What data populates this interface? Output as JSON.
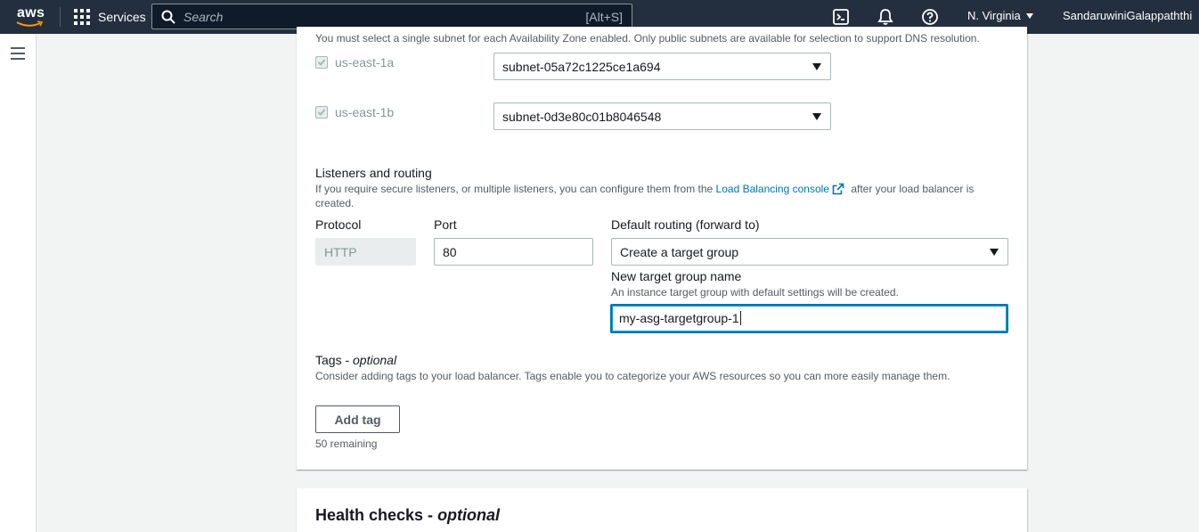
{
  "topnav": {
    "logo_text": "aws",
    "services_label": "Services",
    "search_placeholder": "Search",
    "search_shortcut": "[Alt+S]",
    "region": "N. Virginia",
    "user": "SandaruwiniGalappaththi"
  },
  "subnets": {
    "note": "You must select a single subnet for each Availability Zone enabled. Only public subnets are available for selection to support DNS resolution.",
    "zones": [
      {
        "az": "us-east-1a",
        "subnet": "subnet-05a72c1225ce1a694",
        "checked": true
      },
      {
        "az": "us-east-1b",
        "subnet": "subnet-0d3e80c01b8046548",
        "checked": true
      }
    ]
  },
  "listeners": {
    "title": "Listeners and routing",
    "desc_before": "If you require secure listeners, or multiple listeners, you can configure them from the ",
    "desc_link": "Load Balancing console",
    "desc_after": " after your load balancer is",
    "desc_line2": "created.",
    "protocol_label": "Protocol",
    "protocol_value": "HTTP",
    "port_label": "Port",
    "port_value": "80",
    "routing_label": "Default routing (forward to)",
    "routing_value": "Create a target group",
    "tg_name_label": "New target group name",
    "tg_name_desc": "An instance target group with default settings will be created.",
    "tg_name_value": "my-asg-targetgroup-1"
  },
  "tags": {
    "title": "Tags - ",
    "title_optional": "optional",
    "desc": "Consider adding tags to your load balancer. Tags enable you to categorize your AWS resources so you can more easily manage them.",
    "add_button": "Add tag",
    "remaining": "50 remaining"
  },
  "health": {
    "title": "Health checks - ",
    "title_optional": "optional"
  },
  "colors": {
    "nav_bg": "#232f3e",
    "link": "#0073bb",
    "focus": "#0073bb",
    "page_bg": "#f2f3f3"
  }
}
